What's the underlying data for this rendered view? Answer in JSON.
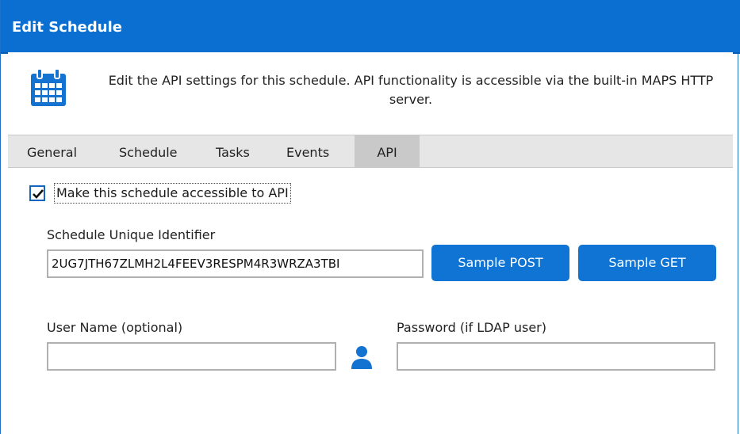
{
  "window": {
    "title": "Edit Schedule"
  },
  "info": {
    "icon": "calendar-icon",
    "text": "Edit the API settings for this schedule.  API functionality is accessible via the built-in MAPS HTTP server."
  },
  "tabs": [
    {
      "label": "General",
      "active": false
    },
    {
      "label": "Schedule",
      "active": false
    },
    {
      "label": "Tasks",
      "active": false
    },
    {
      "label": "Events",
      "active": false
    },
    {
      "label": "API",
      "active": true
    }
  ],
  "api": {
    "accessible_label": "Make this schedule accessible to API",
    "accessible_checked": true,
    "identifier_label": "Schedule Unique Identifier",
    "identifier_value": "2UG7JTH67ZLMH2L4FEEV3RESPM4R3WRZA3TBI",
    "sample_post_label": "Sample POST",
    "sample_get_label": "Sample GET",
    "username_label": "User Name (optional)",
    "username_value": "",
    "password_label": "Password (if LDAP user)",
    "password_value": "",
    "user_icon": "user-icon"
  },
  "colors": {
    "title_bar": "#0a6fd0",
    "accent": "#0f74d3",
    "tab_strip": "#e6e6e6",
    "active_tab": "#c9c9c9"
  }
}
